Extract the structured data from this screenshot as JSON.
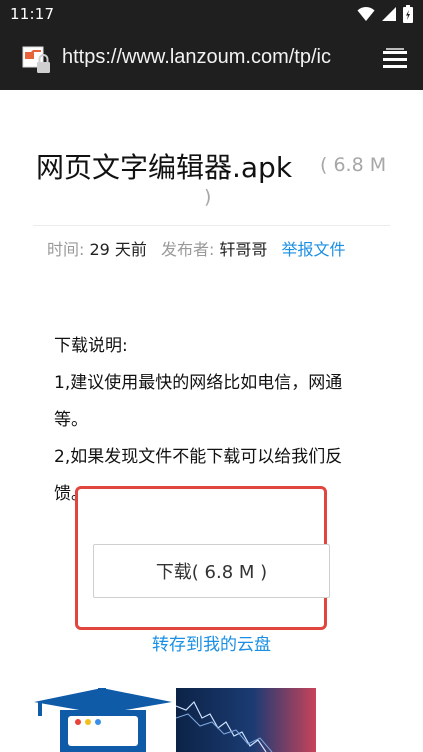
{
  "status_bar": {
    "time": "11:17",
    "icons": [
      "wifi-icon",
      "signal-icon",
      "battery-icon"
    ]
  },
  "browser": {
    "url": "https://www.lanzoum.com/tp/ic"
  },
  "file": {
    "name": "网页文字编辑器.apk",
    "size_open": "( 6.8 M",
    "size_close": ")",
    "time_label": "时间: ",
    "time_value": "29 天前",
    "publisher_label": "发布者: ",
    "publisher_value": "轩哥哥",
    "report_link": "举报文件"
  },
  "description": {
    "lines": [
      "下载说明:",
      "1,建议使用最快的网络比如电信，网通等。",
      "2,如果发现文件不能下载可以给我们反馈。"
    ]
  },
  "actions": {
    "download_label": "下载( 6.8 M )",
    "save_to_cloud": "转存到我的云盘"
  },
  "colors": {
    "link": "#1a8fe3",
    "highlight": "#e0463e",
    "toolbar": "#1f1f1f"
  }
}
